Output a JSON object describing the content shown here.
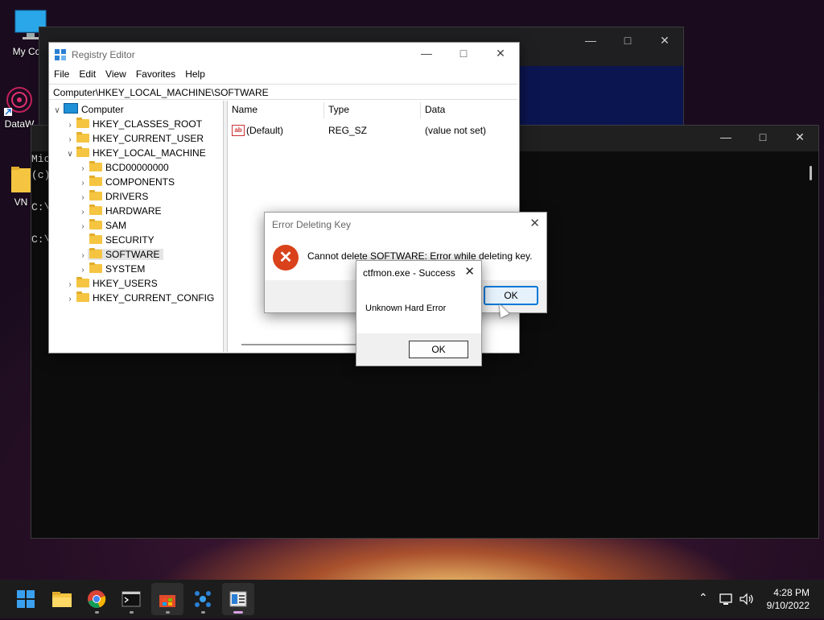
{
  "desktop": {
    "icons": [
      {
        "label": "My Com",
        "icon": "monitor-icon"
      },
      {
        "label": "DataW",
        "icon": "datawrapper-icon"
      },
      {
        "label": "VN",
        "icon": "folder-icon"
      }
    ]
  },
  "console": {
    "lines": [
      "Mic",
      "(c)",
      "",
      "C:\\",
      "",
      "C:\\"
    ]
  },
  "regedit": {
    "title": "Registry Editor",
    "menu": [
      "File",
      "Edit",
      "View",
      "Favorites",
      "Help"
    ],
    "address": "Computer\\HKEY_LOCAL_MACHINE\\SOFTWARE",
    "tree": {
      "root": "Computer",
      "hives": [
        "HKEY_CLASSES_ROOT",
        "HKEY_CURRENT_USER",
        "HKEY_LOCAL_MACHINE",
        "HKEY_USERS",
        "HKEY_CURRENT_CONFIG"
      ],
      "hklm_children": [
        "BCD00000000",
        "COMPONENTS",
        "DRIVERS",
        "HARDWARE",
        "SAM",
        "SECURITY",
        "SOFTWARE",
        "SYSTEM"
      ],
      "selected": "SOFTWARE"
    },
    "columns": [
      "Name",
      "Type",
      "Data"
    ],
    "values": [
      {
        "name": "(Default)",
        "type": "REG_SZ",
        "data": "(value not set)"
      }
    ]
  },
  "error_dialog": {
    "title": "Error Deleting Key",
    "message": "Cannot delete SOFTWARE:  Error while deleting key.",
    "ok_label": "OK"
  },
  "success_dialog": {
    "title": "ctfmon.exe - Success",
    "message": "Unknown Hard Error",
    "ok_label": "OK"
  },
  "taskbar": {
    "apps": [
      "start-icon",
      "file-explorer-icon",
      "chrome-icon",
      "terminal-icon",
      "store-icon",
      "network-app-icon",
      "regedit-icon"
    ],
    "time": "4:28 PM",
    "date": "9/10/2022"
  }
}
